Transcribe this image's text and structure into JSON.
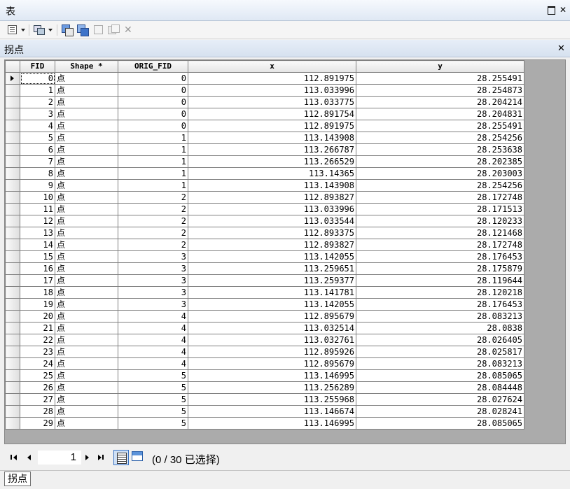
{
  "window": {
    "title": "表"
  },
  "tab": {
    "name": "拐点"
  },
  "columns": [
    "FID",
    "Shape *",
    "ORIG_FID",
    "x",
    "y"
  ],
  "rows": [
    [
      "0",
      "点",
      "0",
      "112.891975",
      "28.255491"
    ],
    [
      "1",
      "点",
      "0",
      "113.033996",
      "28.254873"
    ],
    [
      "2",
      "点",
      "0",
      "113.033775",
      "28.204214"
    ],
    [
      "3",
      "点",
      "0",
      "112.891754",
      "28.204831"
    ],
    [
      "4",
      "点",
      "0",
      "112.891975",
      "28.255491"
    ],
    [
      "5",
      "点",
      "1",
      "113.143908",
      "28.254256"
    ],
    [
      "6",
      "点",
      "1",
      "113.266787",
      "28.253638"
    ],
    [
      "7",
      "点",
      "1",
      "113.266529",
      "28.202385"
    ],
    [
      "8",
      "点",
      "1",
      "113.14365",
      "28.203003"
    ],
    [
      "9",
      "点",
      "1",
      "113.143908",
      "28.254256"
    ],
    [
      "10",
      "点",
      "2",
      "112.893827",
      "28.172748"
    ],
    [
      "11",
      "点",
      "2",
      "113.033996",
      "28.171513"
    ],
    [
      "12",
      "点",
      "2",
      "113.033544",
      "28.120233"
    ],
    [
      "13",
      "点",
      "2",
      "112.893375",
      "28.121468"
    ],
    [
      "14",
      "点",
      "2",
      "112.893827",
      "28.172748"
    ],
    [
      "15",
      "点",
      "3",
      "113.142055",
      "28.176453"
    ],
    [
      "16",
      "点",
      "3",
      "113.259651",
      "28.175879"
    ],
    [
      "17",
      "点",
      "3",
      "113.259377",
      "28.119644"
    ],
    [
      "18",
      "点",
      "3",
      "113.141781",
      "28.120218"
    ],
    [
      "19",
      "点",
      "3",
      "113.142055",
      "28.176453"
    ],
    [
      "20",
      "点",
      "4",
      "112.895679",
      "28.083213"
    ],
    [
      "21",
      "点",
      "4",
      "113.032514",
      "28.0838"
    ],
    [
      "22",
      "点",
      "4",
      "113.032761",
      "28.026405"
    ],
    [
      "23",
      "点",
      "4",
      "112.895926",
      "28.025817"
    ],
    [
      "24",
      "点",
      "4",
      "112.895679",
      "28.083213"
    ],
    [
      "25",
      "点",
      "5",
      "113.146995",
      "28.085065"
    ],
    [
      "26",
      "点",
      "5",
      "113.256289",
      "28.084448"
    ],
    [
      "27",
      "点",
      "5",
      "113.255968",
      "28.027624"
    ],
    [
      "28",
      "点",
      "5",
      "113.146674",
      "28.028241"
    ],
    [
      "29",
      "点",
      "5",
      "113.146995",
      "28.085065"
    ]
  ],
  "navigation": {
    "page": "1",
    "status": "(0 / 30 已选择)"
  },
  "bottom_tab": {
    "label": "拐点"
  }
}
